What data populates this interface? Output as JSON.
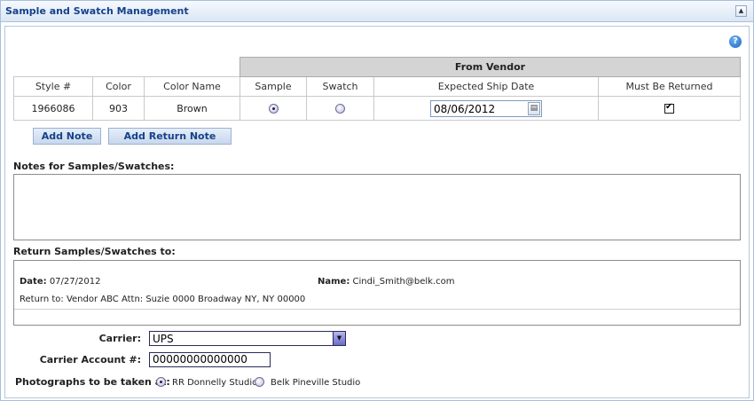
{
  "panel": {
    "title": "Sample and Swatch Management",
    "collapse_glyph": "▲",
    "help_glyph": "?"
  },
  "table": {
    "group_header": "From Vendor",
    "columns": [
      "Style #",
      "Color",
      "Color Name",
      "Sample",
      "Swatch",
      "Expected Ship Date",
      "Must Be Returned"
    ],
    "row": {
      "style": "1966086",
      "color": "903",
      "color_name": "Brown",
      "sample_selected": true,
      "swatch_selected": false,
      "expected_ship_date": "08/06/2012",
      "must_be_returned": true
    }
  },
  "buttons": {
    "add_note": "Add Note",
    "add_return_note": "Add Return Note"
  },
  "notes": {
    "label": "Notes for Samples/Swatches:",
    "value": ""
  },
  "return_info": {
    "label": "Return Samples/Swatches to:",
    "date_label": "Date:",
    "date_value": "07/27/2012",
    "name_label": "Name:",
    "name_value": "Cindi_Smith@belk.com",
    "return_to_text": "Return to: Vendor ABC Attn: Suzie 0000 Broadway NY, NY 00000"
  },
  "carrier": {
    "label": "Carrier:",
    "value": "UPS"
  },
  "carrier_account": {
    "label": "Carrier Account #:",
    "value": "00000000000000"
  },
  "photographs": {
    "label": "Photographs to be taken at:",
    "options": [
      {
        "label": "RR Donnelly Studio",
        "selected": true
      },
      {
        "label": "Belk Pineville Studio",
        "selected": false
      }
    ]
  },
  "colors": {
    "header_text": "#15428b",
    "group_header_bg": "#d4d4d4",
    "border": "#a8c0dc"
  }
}
